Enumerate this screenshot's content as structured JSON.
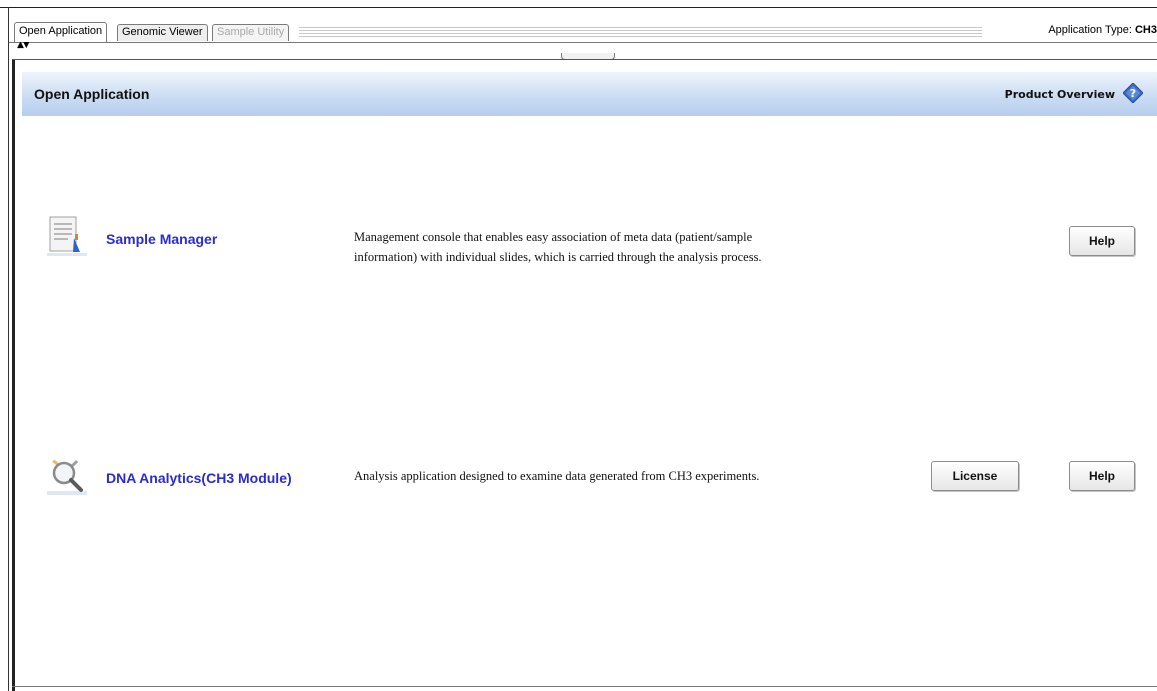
{
  "tabs": [
    {
      "label": "Open Application",
      "state": "active"
    },
    {
      "label": "Genomic Viewer",
      "state": "inactive"
    },
    {
      "label": "Sample Utility",
      "state": "disabled"
    }
  ],
  "app_type": {
    "label": "Application Type:",
    "value": "CH3"
  },
  "header": {
    "title": "Open Application",
    "overview_label": "Product Overview",
    "overview_icon": "help-diamond-icon"
  },
  "applications": [
    {
      "name": "Sample Manager",
      "icon": "sample-manager-icon",
      "description_lines": [
        "Management console that enables easy association of meta data (patient/sample",
        "information) with individual slides, which is carried through the analysis process."
      ],
      "buttons": {
        "help": "Help"
      }
    },
    {
      "name": "DNA Analytics(CH3 Module)",
      "icon": "dna-analytics-icon",
      "description_lines": [
        "Analysis application designed to examine data generated from CH3 experiments."
      ],
      "buttons": {
        "license": "License",
        "help": "Help"
      }
    }
  ],
  "colors": {
    "link": "#2a2ad8",
    "header_band": "#c9dbf3",
    "help_icon": "#3c6fc4"
  }
}
